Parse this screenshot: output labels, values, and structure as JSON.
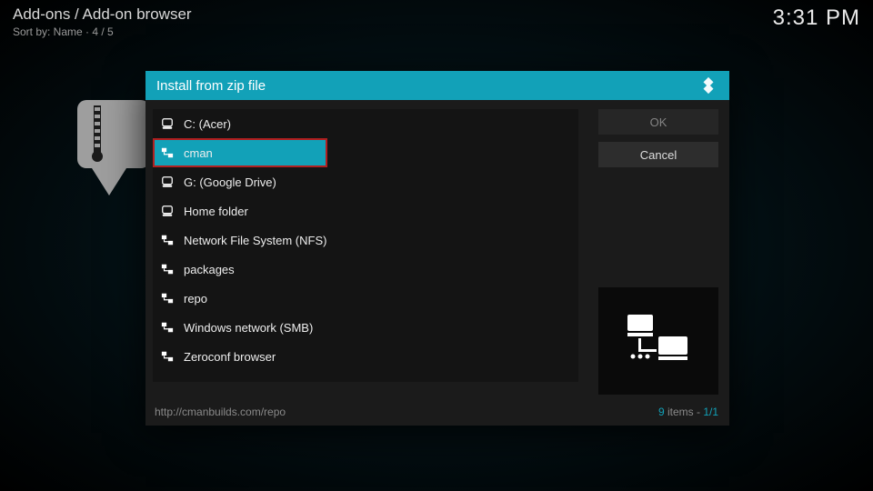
{
  "header": {
    "breadcrumb": "Add-ons / Add-on browser",
    "sort_line": "Sort by: Name  ·  4 / 5",
    "clock": "3:31 PM"
  },
  "dialog": {
    "title": "Install from zip file",
    "buttons": {
      "ok": "OK",
      "cancel": "Cancel"
    },
    "footer_path": "http://cmanbuilds.com/repo",
    "footer_count": "9",
    "footer_items_word": " items - ",
    "footer_page": "1/1"
  },
  "rows": [
    {
      "icon": "drive",
      "label": "C: (Acer)"
    },
    {
      "icon": "net",
      "label": "cman",
      "selected": true,
      "boxed": true
    },
    {
      "icon": "drive",
      "label": "G: (Google Drive)"
    },
    {
      "icon": "drive",
      "label": "Home folder"
    },
    {
      "icon": "net",
      "label": "Network File System (NFS)"
    },
    {
      "icon": "net",
      "label": "packages"
    },
    {
      "icon": "net",
      "label": "repo"
    },
    {
      "icon": "net",
      "label": "Windows network (SMB)"
    },
    {
      "icon": "net",
      "label": "Zeroconf browser"
    }
  ],
  "icons": {
    "drive": "drive-icon",
    "net": "network-share-icon",
    "logo": "kodi-logo-icon",
    "zip": "zip-download-icon",
    "preview": "network-computers-icon"
  }
}
